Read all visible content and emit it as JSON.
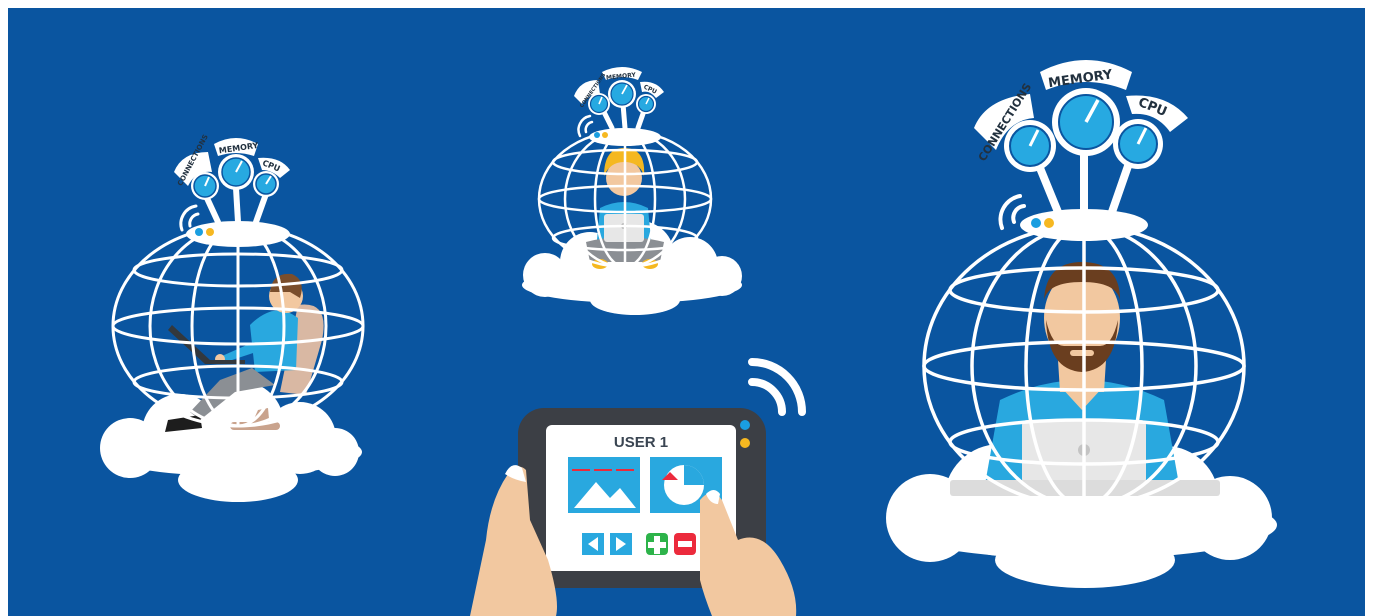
{
  "scene": {
    "colors": {
      "background": "#0a55a0",
      "white": "#ffffff",
      "gauge_blue": "#27a9e1",
      "dot_blue": "#1a9ee0",
      "dot_yellow": "#f6b821",
      "shirt_blue": "#29a8df",
      "skin": "#f2c8a0",
      "hair_brown": "#7a4e2c",
      "hair_yellow": "#f5b820",
      "beard": "#6a3e1f",
      "tablet_dark": "#3c3f45",
      "green": "#2db34a",
      "red": "#ec2a3c",
      "laptop": "#e7e7e7"
    },
    "gauge_labels": {
      "connections": "CONNECTIONS",
      "memory": "MEMORY",
      "cpu": "CPU"
    },
    "icons": [
      "wifi-icon",
      "image-icon",
      "pie-chart-icon",
      "prev-icon",
      "next-icon",
      "plus-icon",
      "minus-icon"
    ]
  },
  "tablet": {
    "title": "USER 1"
  }
}
